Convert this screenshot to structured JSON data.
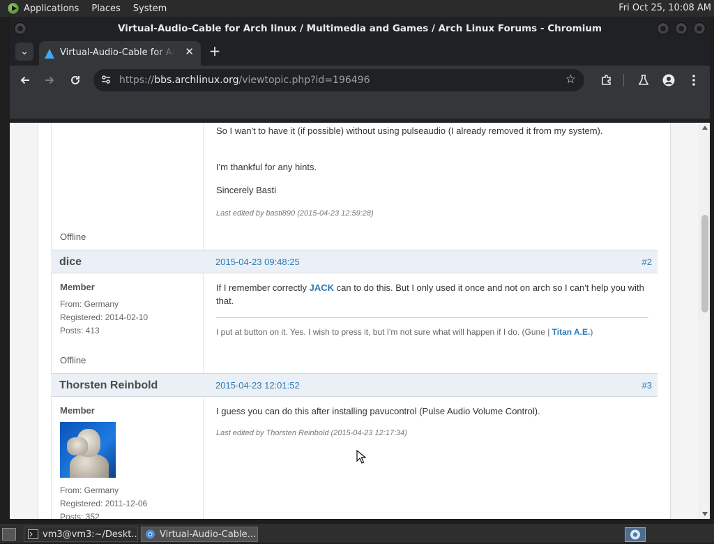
{
  "top_panel": {
    "menus": [
      "Applications",
      "Places",
      "System"
    ],
    "clock": "Fri Oct 25, 10:08 AM"
  },
  "window": {
    "title": "Virtual-Audio-Cable for Arch linux / Multimedia and Games / Arch Linux Forums - Chromium"
  },
  "tabs": [
    {
      "title": "Virtual-Audio-Cable for Arch linux / Multimedia and Games / Arch Linux Forums"
    }
  ],
  "address_bar": {
    "scheme": "https://",
    "host": "bbs.archlinux.org",
    "path": "/viewtopic.php?id=196496"
  },
  "posts": {
    "p1": {
      "lines": [
        "So I wan't to have it (if possible) without using pulseaudio (I already removed it from my system).",
        "I'm thankful for any hints.",
        "Sincerely Basti"
      ],
      "edited": "Last edited by basti890 (2015-04-23 12:59:28)",
      "status": "Offline"
    },
    "p2": {
      "author": "dice",
      "date": "2015-04-23 09:48:25",
      "number": "#2",
      "role": "Member",
      "from": "From: Germany",
      "registered": "Registered: 2014-02-10",
      "posts": "Posts: 413",
      "status": "Offline",
      "msg_pre": "If I remember correctly ",
      "msg_link": "JACK",
      "msg_post": " can to do this. But I only used it once and not on arch so I can't help you with that.",
      "sig_pre": "I put at button on it. Yes. I wish to press it, but I'm not sure what will happen if I do.  (Gune | ",
      "sig_link": "Titan A.E.",
      "sig_post": ")"
    },
    "p3": {
      "author": "Thorsten Reinbold",
      "date": "2015-04-23 12:01:52",
      "number": "#3",
      "role": "Member",
      "from": "From: Germany",
      "registered": "Registered: 2011-12-06",
      "posts": "Posts: 352",
      "msg": "I guess you can do this after installing pavucontrol (Pulse Audio Volume Control).",
      "edited": "Last edited by Thorsten Reinbold (2015-04-23 12:17:34)"
    }
  },
  "taskbar": {
    "tasks": [
      {
        "label": "vm3@vm3:~/Deskt..."
      },
      {
        "label": "Virtual-Audio-Cable..."
      }
    ]
  },
  "colors": {
    "link": "#2a7bb8",
    "post_header_bg": "#eaf0f5",
    "browser_frame": "#202124",
    "toolbar": "#35363a"
  }
}
